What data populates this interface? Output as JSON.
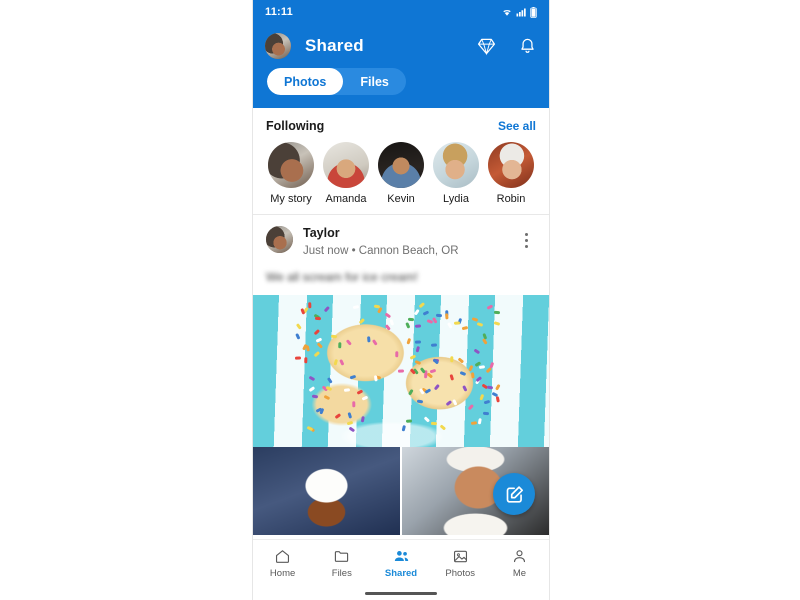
{
  "status_bar": {
    "time": "11:11",
    "icons": [
      "wifi-icon",
      "cellular-signal-icon",
      "battery-icon"
    ]
  },
  "app_bar": {
    "title": "Shared",
    "avatar_name": "user-avatar",
    "actions": [
      {
        "name": "premium-diamond-icon",
        "label": "Premium"
      },
      {
        "name": "notifications-bell-icon",
        "label": "Notifications"
      }
    ]
  },
  "tabs": {
    "items": [
      {
        "label": "Photos",
        "active": true
      },
      {
        "label": "Files",
        "active": false
      }
    ]
  },
  "following": {
    "title": "Following",
    "see_all": "See all",
    "people": [
      {
        "name": "My story",
        "avatar": "my-story-avatar"
      },
      {
        "name": "Amanda",
        "avatar": "amanda-avatar"
      },
      {
        "name": "Kevin",
        "avatar": "kevin-avatar"
      },
      {
        "name": "Lydia",
        "avatar": "lydia-avatar"
      },
      {
        "name": "Robin",
        "avatar": "robin-avatar"
      }
    ]
  },
  "post": {
    "author": "Taylor",
    "subtitle": "Just now • Cannon Beach, OR",
    "caption": "We all scream for ice cream!",
    "more_label": "More options",
    "hero_photo": "ice-cream-with-sprinkles-photo",
    "thumbnails": [
      {
        "alt": "sundae-with-whipped-cream-photo"
      },
      {
        "alt": "smiling-baby-photo"
      }
    ]
  },
  "fab": {
    "label": "Compose",
    "icon": "compose-edit-icon"
  },
  "bottom_nav": {
    "items": [
      {
        "label": "Home",
        "icon": "home-icon",
        "active": false
      },
      {
        "label": "Files",
        "icon": "folder-icon",
        "active": false
      },
      {
        "label": "Shared",
        "icon": "people-icon",
        "active": true
      },
      {
        "label": "Photos",
        "icon": "image-icon",
        "active": false
      },
      {
        "label": "Me",
        "icon": "person-icon",
        "active": false
      }
    ]
  },
  "colors": {
    "brand_blue": "#0f76d4",
    "accent_blue": "#1b8ad8",
    "segment_track": "#2a8ae0",
    "text_primary": "#1b1b1b",
    "text_secondary": "#707070"
  }
}
